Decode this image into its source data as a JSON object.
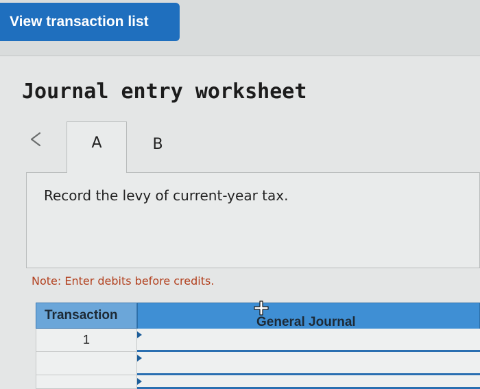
{
  "header": {
    "view_transaction_list_label": "View transaction list"
  },
  "worksheet": {
    "title": "Journal entry worksheet",
    "tabs": [
      {
        "label": "A",
        "active": true
      },
      {
        "label": "B",
        "active": false
      }
    ],
    "instruction": "Record the levy of current-year tax.",
    "note": "Note: Enter debits before credits."
  },
  "table": {
    "columns": [
      "Transaction",
      "General Journal"
    ],
    "rows": [
      {
        "transaction": "1",
        "general_journal": ""
      },
      {
        "transaction": "",
        "general_journal": ""
      },
      {
        "transaction": "",
        "general_journal": ""
      }
    ]
  },
  "icons": {
    "prev": "chevron-left-icon",
    "move_cursor": "move-cursor-icon"
  },
  "colors": {
    "accent": "#1f6fbe",
    "header_light": "#6ba6d9",
    "header_dark": "#3f8fd4",
    "note_text": "#b2401e"
  }
}
